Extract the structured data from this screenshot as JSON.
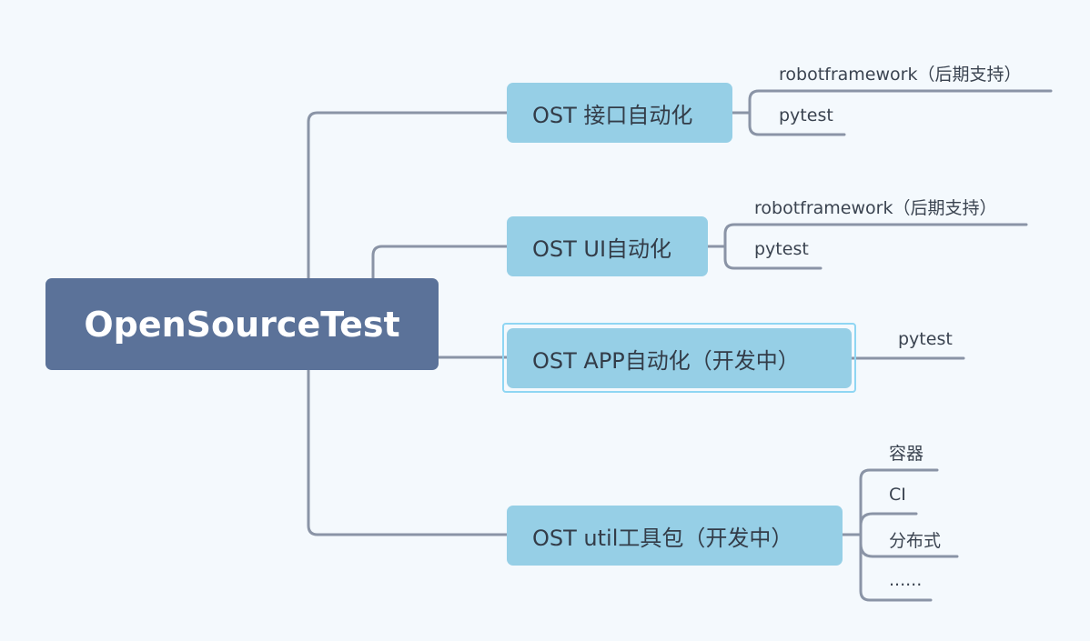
{
  "root": {
    "label": "OpenSourceTest"
  },
  "topics": [
    {
      "id": "api",
      "label": "OST 接口自动化",
      "leaves": [
        "robotframework（后期支持）",
        "pytest"
      ]
    },
    {
      "id": "ui",
      "label": "OST UI自动化",
      "leaves": [
        "robotframework（后期支持）",
        "pytest"
      ]
    },
    {
      "id": "app",
      "label": "OST APP自动化（开发中）",
      "selected": true,
      "leaves": [
        "pytest"
      ]
    },
    {
      "id": "util",
      "label": "OST util工具包（开发中）",
      "leaves": [
        "容器",
        "CI",
        "分布式",
        "......"
      ]
    }
  ],
  "colors": {
    "background": "#f4f9fd",
    "root_fill": "#5b7299",
    "topic_fill": "#96cfe6",
    "connector": "#8a94a6",
    "selection": "#8fd6f3"
  }
}
